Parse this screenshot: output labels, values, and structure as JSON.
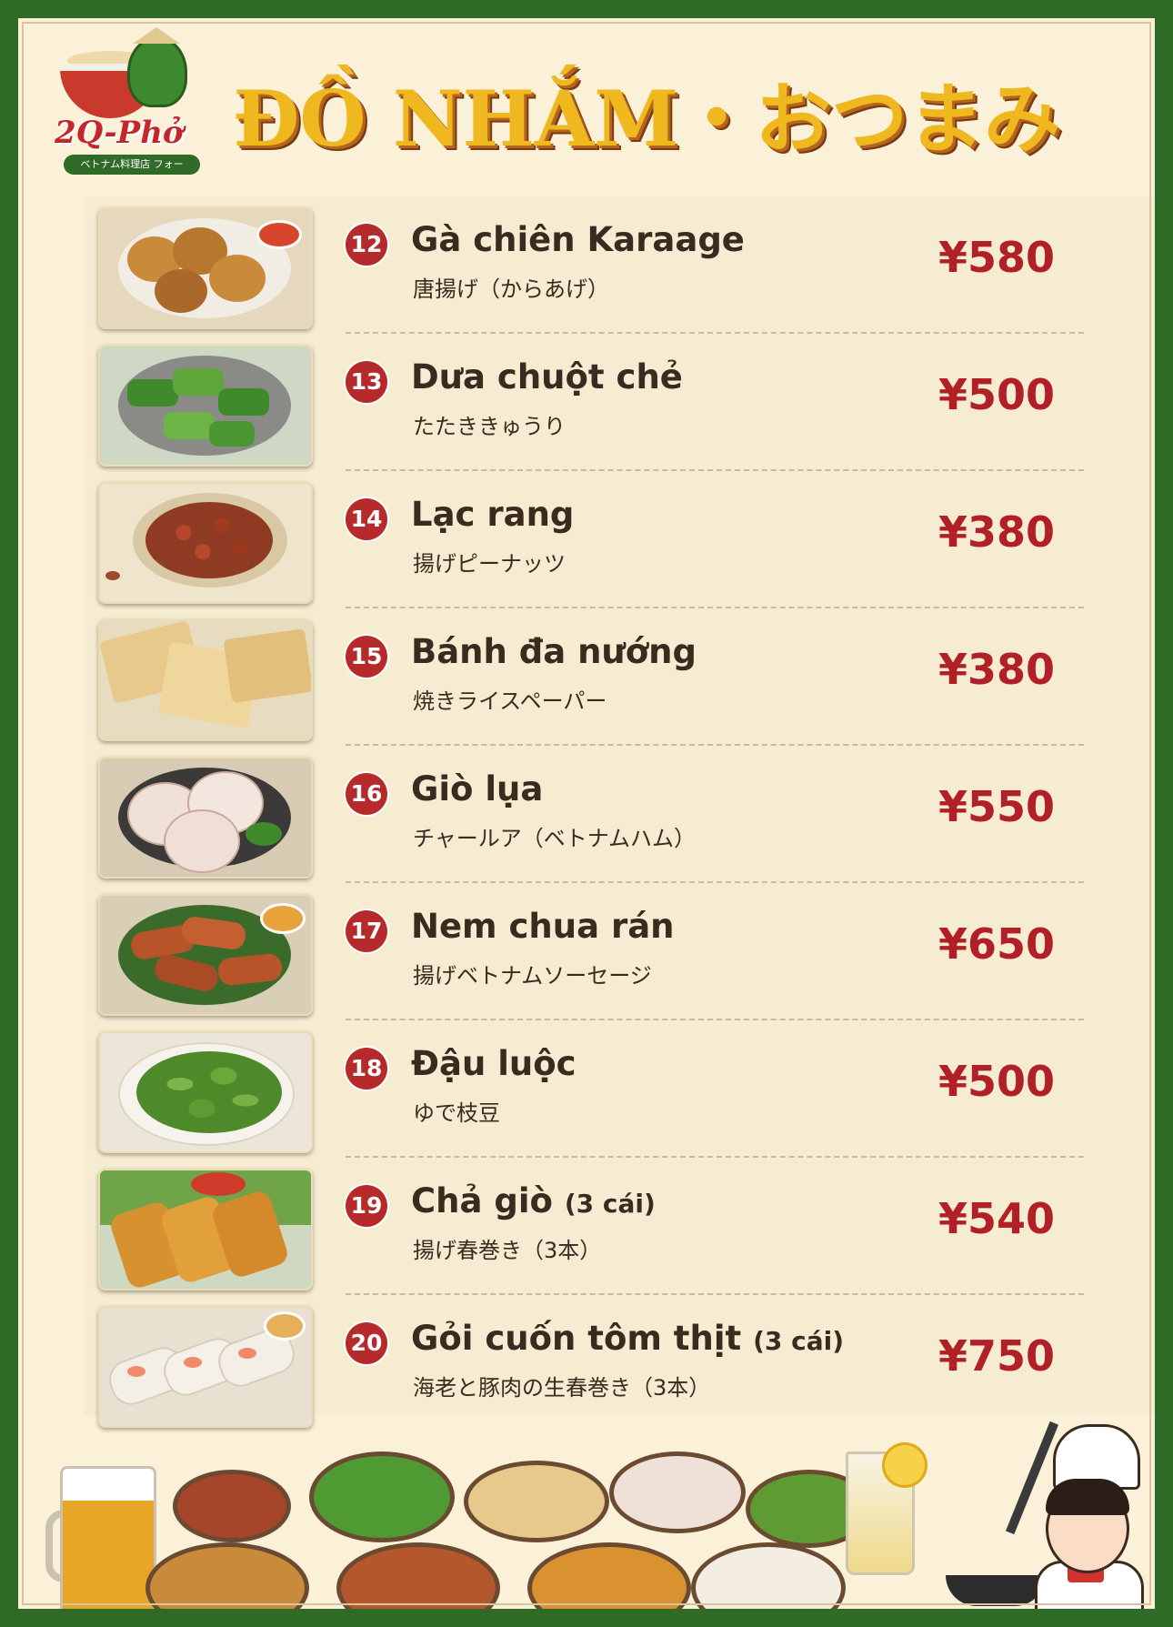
{
  "header": {
    "logo_name": "2Q-Phở",
    "logo_tagline": "ベトナム料理店 フォー",
    "title": "ĐỒ NHẮM・おつまみ"
  },
  "items": [
    {
      "num": "12",
      "name": "Gà chiên Karaage",
      "qty": "",
      "jp": "唐揚げ（からあげ）",
      "price": "¥580"
    },
    {
      "num": "13",
      "name": "Dưa chuột chẻ",
      "qty": "",
      "jp": "たたききゅうり",
      "price": "¥500"
    },
    {
      "num": "14",
      "name": "Lạc rang",
      "qty": "",
      "jp": "揚げピーナッツ",
      "price": "¥380"
    },
    {
      "num": "15",
      "name": "Bánh đa nướng",
      "qty": "",
      "jp": "焼きライスペーパー",
      "price": "¥380"
    },
    {
      "num": "16",
      "name": "Giò lụa",
      "qty": "",
      "jp": "チャールア（ベトナムハム）",
      "price": "¥550"
    },
    {
      "num": "17",
      "name": "Nem chua rán",
      "qty": "",
      "jp": "揚げベトナムソーセージ",
      "price": "¥650"
    },
    {
      "num": "18",
      "name": "Đậu luộc",
      "qty": "",
      "jp": "ゆで枝豆",
      "price": "¥500"
    },
    {
      "num": "19",
      "name": "Chả giò",
      "qty": "(3 cái)",
      "jp": "揚げ春巻き（3本）",
      "price": "¥540"
    },
    {
      "num": "20",
      "name": "Gỏi cuốn tôm thịt",
      "qty": "(3 cái)",
      "jp": "海老と豚肉の生春巻き（3本）",
      "price": "¥750"
    }
  ],
  "colors": {
    "border_green": "#2f6a26",
    "title_gold": "#f0b81f",
    "price_red": "#b12026",
    "badge_red": "#b62a2b"
  }
}
